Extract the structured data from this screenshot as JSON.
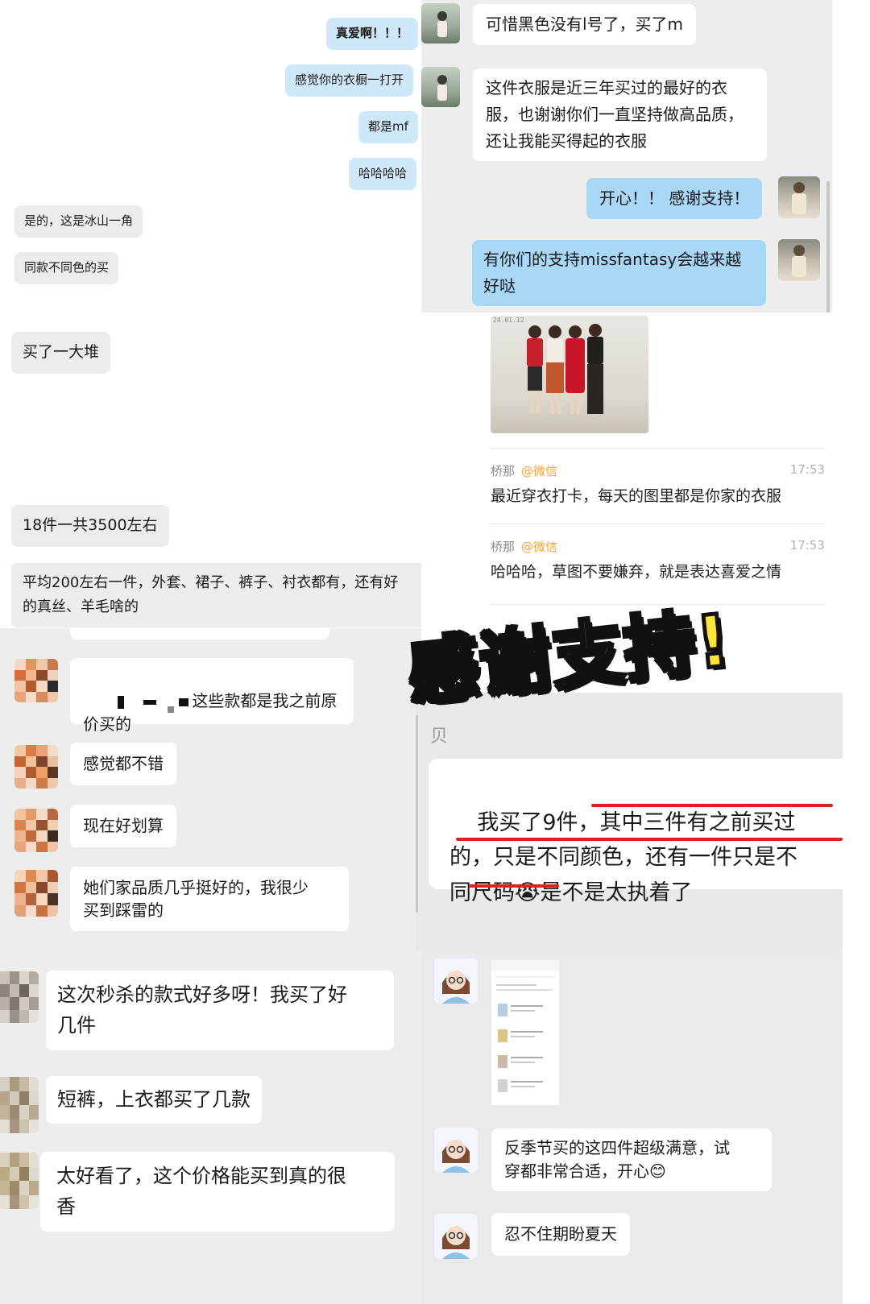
{
  "panel_top_left": {
    "bubbles": [
      "真爱啊！！！",
      "感觉你的衣橱一打开",
      "都是mf",
      "哈哈哈哈",
      "是的，这是冰山一角",
      "同款不同色的买"
    ]
  },
  "panel_top_right": {
    "messages": [
      "可惜黑色没有l号了，买了m",
      "这件衣服是近三年买过的最好的衣服，也谢谢你们一直坚持做高品质，还让我能买得起的衣服",
      "开心！！ 感谢支持！",
      "有你们的支持missfantasy会越来越好哒"
    ]
  },
  "panel_mid_left": {
    "bubbles": [
      "买了一大堆",
      "18件一共3500左右",
      "平均200左右一件，外套、裙子、裤子、衬衣都有，还有好\n的真丝、羊毛啥的"
    ]
  },
  "panel_mid_right": {
    "photo_date": "24.01.12",
    "comments": [
      {
        "user": "桥那",
        "source": "@微信",
        "time": "17:53",
        "text": "最近穿衣打卡，每天的图里都是你家的衣服"
      },
      {
        "user": "桥那",
        "source": "@微信",
        "time": "17:53",
        "text": "哈哈哈，草图不要嫌弃，就是表达喜爱之情"
      }
    ]
  },
  "headline": "感谢支持!",
  "panel_lower_left": {
    "messages": [
      "这些款都是我之前原\n价买的",
      "感觉都不错",
      "现在好划算",
      "她们家品质几乎挺好的，我很少\n买到踩雷的"
    ]
  },
  "panel_lower_right": {
    "name_char": "贝",
    "message": "我买了9件，其中三件有之前买过\n的，只是不同颜色，还有一件只是不\n同尺码😭是不是太执着了"
  },
  "panel_bottom_left": {
    "messages": [
      "这次秒杀的款式好多呀！我买了好\n几件",
      "短裤，上衣都买了几款",
      "太好看了，这个价格能买到真的很\n香"
    ]
  },
  "panel_bottom_right": {
    "messages": [
      "反季节买的这四件超级满意，试\n穿都非常合适，开心😊",
      "忍不住期盼夏天"
    ]
  },
  "colors": {
    "highlight_yellow": "#ffe33a",
    "underline_red": "#e0201b",
    "wechat_orange": "#f0a23c"
  }
}
